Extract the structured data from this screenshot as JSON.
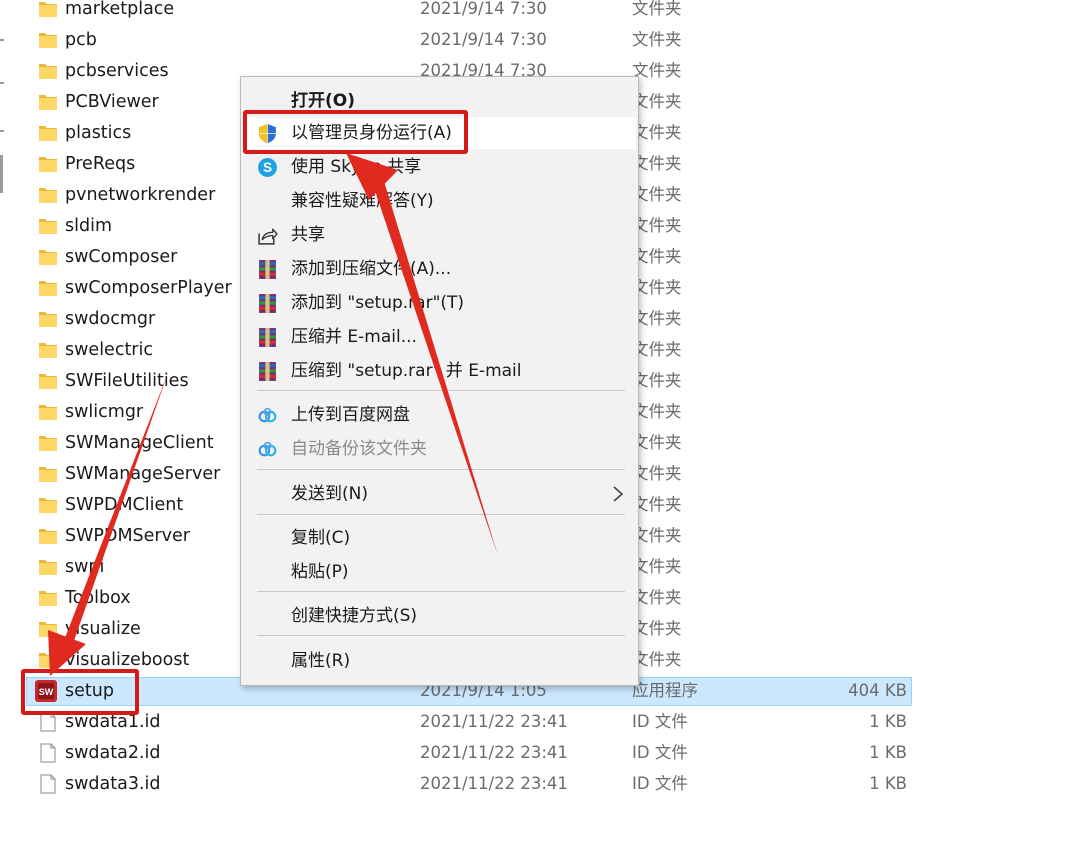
{
  "file_list": {
    "rows": [
      {
        "name": "marketplace",
        "date": "2021/9/14 7:30",
        "type": "文件夹",
        "size": "",
        "icon": "folder-icon"
      },
      {
        "name": "pcb",
        "date": "2021/9/14 7:30",
        "type": "文件夹",
        "size": "",
        "icon": "folder-icon"
      },
      {
        "name": "pcbservices",
        "date": "2021/9/14 7:30",
        "type": "文件夹",
        "size": "",
        "icon": "folder-icon"
      },
      {
        "name": "PCBViewer",
        "date": "",
        "type": "文件夹",
        "size": "",
        "icon": "folder-icon"
      },
      {
        "name": "plastics",
        "date": "",
        "type": "文件夹",
        "size": "",
        "icon": "folder-icon"
      },
      {
        "name": "PreReqs",
        "date": "",
        "type": "文件夹",
        "size": "",
        "icon": "folder-icon"
      },
      {
        "name": "pvnetworkrender",
        "date": "",
        "type": "文件夹",
        "size": "",
        "icon": "folder-icon"
      },
      {
        "name": "sldim",
        "date": "",
        "type": "文件夹",
        "size": "",
        "icon": "folder-icon"
      },
      {
        "name": "swComposer",
        "date": "",
        "type": "文件夹",
        "size": "",
        "icon": "folder-icon"
      },
      {
        "name": "swComposerPlayer",
        "date": "",
        "type": "文件夹",
        "size": "",
        "icon": "folder-icon"
      },
      {
        "name": "swdocmgr",
        "date": "",
        "type": "文件夹",
        "size": "",
        "icon": "folder-icon"
      },
      {
        "name": "swelectric",
        "date": "",
        "type": "文件夹",
        "size": "",
        "icon": "folder-icon"
      },
      {
        "name": "SWFileUtilities",
        "date": "",
        "type": "文件夹",
        "size": "",
        "icon": "folder-icon"
      },
      {
        "name": "swlicmgr",
        "date": "",
        "type": "文件夹",
        "size": "",
        "icon": "folder-icon"
      },
      {
        "name": "SWManageClient",
        "date": "",
        "type": "文件夹",
        "size": "",
        "icon": "folder-icon"
      },
      {
        "name": "SWManageServer",
        "date": "",
        "type": "文件夹",
        "size": "",
        "icon": "folder-icon"
      },
      {
        "name": "SWPDMClient",
        "date": "",
        "type": "文件夹",
        "size": "",
        "icon": "folder-icon"
      },
      {
        "name": "SWPDMServer",
        "date": "",
        "type": "文件夹",
        "size": "",
        "icon": "folder-icon"
      },
      {
        "name": "swpi",
        "date": "",
        "type": "文件夹",
        "size": "",
        "icon": "folder-icon"
      },
      {
        "name": "Toolbox",
        "date": "",
        "type": "文件夹",
        "size": "",
        "icon": "folder-icon"
      },
      {
        "name": "visualize",
        "date": "",
        "type": "文件夹",
        "size": "",
        "icon": "folder-icon"
      },
      {
        "name": "visualizeboost",
        "date": "",
        "type": "文件夹",
        "size": "",
        "icon": "folder-icon"
      },
      {
        "name": "setup",
        "date": "2021/9/14 1:05",
        "type": "应用程序",
        "size": "404 KB",
        "icon": "solidworks-app-icon",
        "selected": true
      },
      {
        "name": "swdata1.id",
        "date": "2021/11/22 23:41",
        "type": "ID 文件",
        "size": "1 KB",
        "icon": "file-icon"
      },
      {
        "name": "swdata2.id",
        "date": "2021/11/22 23:41",
        "type": "ID 文件",
        "size": "1 KB",
        "icon": "file-icon"
      },
      {
        "name": "swdata3.id",
        "date": "2021/11/22 23:41",
        "type": "ID 文件",
        "size": "1 KB",
        "icon": "file-icon"
      }
    ]
  },
  "context_menu": {
    "items": [
      {
        "label": "打开(O)",
        "bold": true,
        "icon": ""
      },
      {
        "label": "以管理员身份运行(A)",
        "icon": "uac-shield-icon",
        "hover": true
      },
      {
        "label": "使用 Skype 共享",
        "icon": "skype-icon"
      },
      {
        "label": "兼容性疑难解答(Y)",
        "icon": ""
      },
      {
        "label": "共享",
        "icon": "share-icon"
      },
      {
        "label": "添加到压缩文件(A)...",
        "icon": "winrar-icon"
      },
      {
        "label": "添加到 \"setup.rar\"(T)",
        "icon": "winrar-icon"
      },
      {
        "label": "压缩并 E-mail...",
        "icon": "winrar-icon"
      },
      {
        "label": "压缩到 \"setup.rar\" 并 E-mail",
        "icon": "winrar-icon"
      },
      {
        "label": "上传到百度网盘",
        "icon": "baidu-netdisk-icon"
      },
      {
        "label": "自动备份该文件夹",
        "icon": "baidu-netdisk-icon",
        "disabled": true
      },
      {
        "label": "发送到(N)",
        "icon": "",
        "submenu": true
      },
      {
        "label": "复制(C)",
        "icon": ""
      },
      {
        "label": "粘贴(P)",
        "icon": ""
      },
      {
        "label": "创建快捷方式(S)",
        "icon": ""
      },
      {
        "label": "属性(R)",
        "icon": ""
      }
    ]
  },
  "annotation_colors": {
    "highlight": "#d61a1a",
    "selection": "#cce8ff"
  }
}
